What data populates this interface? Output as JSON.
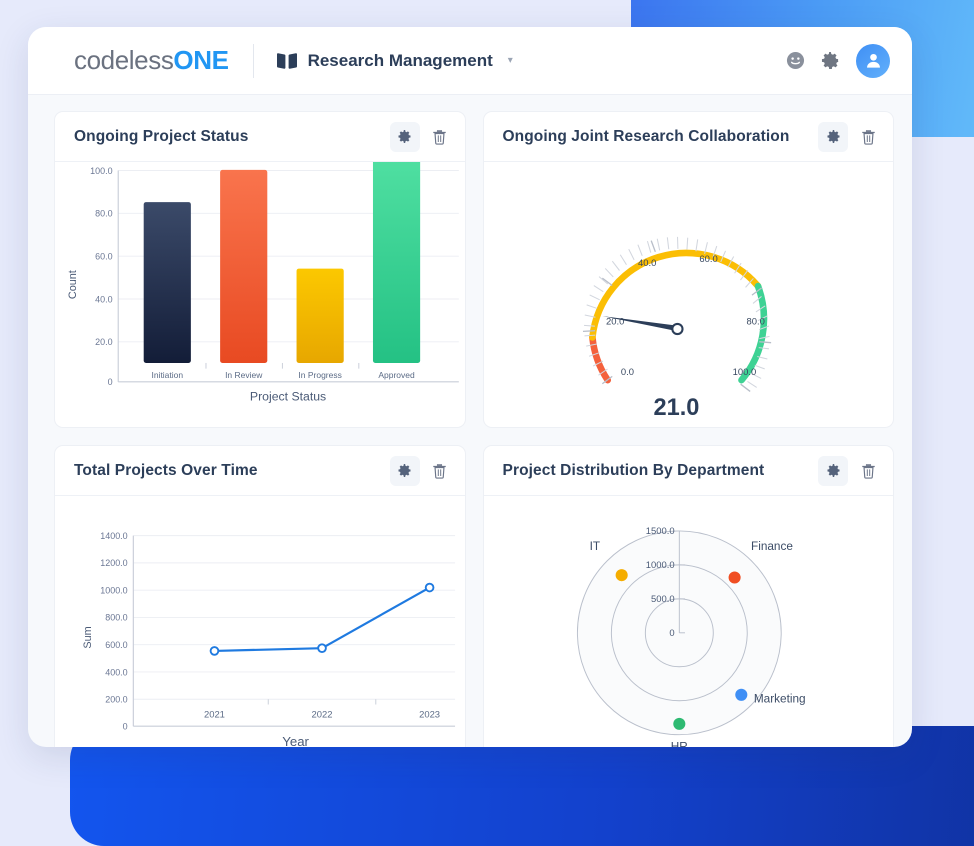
{
  "topbar": {
    "logo_codeless": "codeless",
    "logo_one": "ONE",
    "project_icon": "book-icon",
    "project_name": "Research Management",
    "caret": "▾",
    "emoji_icon": "smiley-icon",
    "settings_icon": "gear-icon",
    "avatar_icon": "user-avatar-icon"
  },
  "cards": {
    "bar": {
      "title": "Ongoing Project Status",
      "gear_icon": "gear-icon",
      "trash_icon": "trash-icon"
    },
    "gauge": {
      "title": "Ongoing Joint Research Collaboration",
      "gear_icon": "gear-icon",
      "trash_icon": "trash-icon"
    },
    "line": {
      "title": "Total Projects Over Time",
      "gear_icon": "gear-icon",
      "trash_icon": "trash-icon"
    },
    "polar": {
      "title": "Project Distribution By Department",
      "gear_icon": "gear-icon",
      "trash_icon": "trash-icon"
    }
  },
  "chart_data": [
    {
      "id": "ongoing-project-status",
      "type": "bar",
      "title": "Ongoing Project Status",
      "xlabel": "Project Status",
      "ylabel": "Count",
      "categories": [
        "Initiation",
        "In Review",
        "In Progress",
        "Approved"
      ],
      "values": [
        75,
        90,
        44,
        99
      ],
      "colors": [
        "#24314f",
        "#f4613c",
        "#f0b800",
        "#3ed294"
      ],
      "ylim": [
        0,
        100
      ],
      "yticks": [
        "0",
        "20.0",
        "40.0",
        "60.0",
        "80.0",
        "100.0"
      ],
      "ytick_values": [
        0,
        20,
        40,
        60,
        80,
        100
      ],
      "grid": true,
      "legend": "none"
    },
    {
      "id": "ongoing-joint-research-collaboration",
      "type": "gauge",
      "title": "Ongoing Joint Research Collaboration",
      "value": 21.0,
      "value_label": "21.0",
      "range": [
        0,
        100
      ],
      "ticks": [
        "0.0",
        "20.0",
        "40.0",
        "60.0",
        "80.0",
        "100.0"
      ],
      "tick_values": [
        0,
        20,
        40,
        60,
        80,
        100
      ],
      "bands": [
        {
          "from": 0,
          "to": 20,
          "color": "#f4613c"
        },
        {
          "from": 20,
          "to": 70,
          "color": "#fbbe04"
        },
        {
          "from": 70,
          "to": 100,
          "color": "#3ed294"
        }
      ],
      "needle_color": "#2c3e59"
    },
    {
      "id": "total-projects-over-time",
      "type": "line",
      "title": "Total Projects Over Time",
      "xlabel": "Year",
      "ylabel": "Sum",
      "categories": [
        "2021",
        "2022",
        "2023"
      ],
      "values": [
        555,
        575,
        1020
      ],
      "ylim": [
        0,
        1400
      ],
      "yticks": [
        "0",
        "200.0",
        "400.0",
        "600.0",
        "800.0",
        "1000.0",
        "1200.0",
        "1400.0"
      ],
      "ytick_values": [
        0,
        200,
        400,
        600,
        800,
        1000,
        1200,
        1400
      ],
      "color": "#1f7ae0",
      "grid": true,
      "legend": "none"
    },
    {
      "id": "project-distribution-by-department",
      "type": "scatter",
      "subtype": "polar",
      "title": "Project Distribution By Department",
      "radial_ticks": [
        "0",
        "500.0",
        "1000.0",
        "1500.0"
      ],
      "radial_tick_values": [
        0,
        500,
        1000,
        1500
      ],
      "rlim": [
        0,
        1500
      ],
      "points": [
        {
          "label": "Finance",
          "value": 1150,
          "angle_deg": 45,
          "color": "#f04e23"
        },
        {
          "label": "Marketing",
          "value": 1290,
          "angle_deg": -45,
          "color": "#3f8ff5"
        },
        {
          "label": "HR",
          "value": 1340,
          "angle_deg": -90,
          "color": "#2eba72"
        },
        {
          "label": "IT",
          "value": 1200,
          "angle_deg": 135,
          "color": "#f5ad00"
        }
      ]
    }
  ]
}
